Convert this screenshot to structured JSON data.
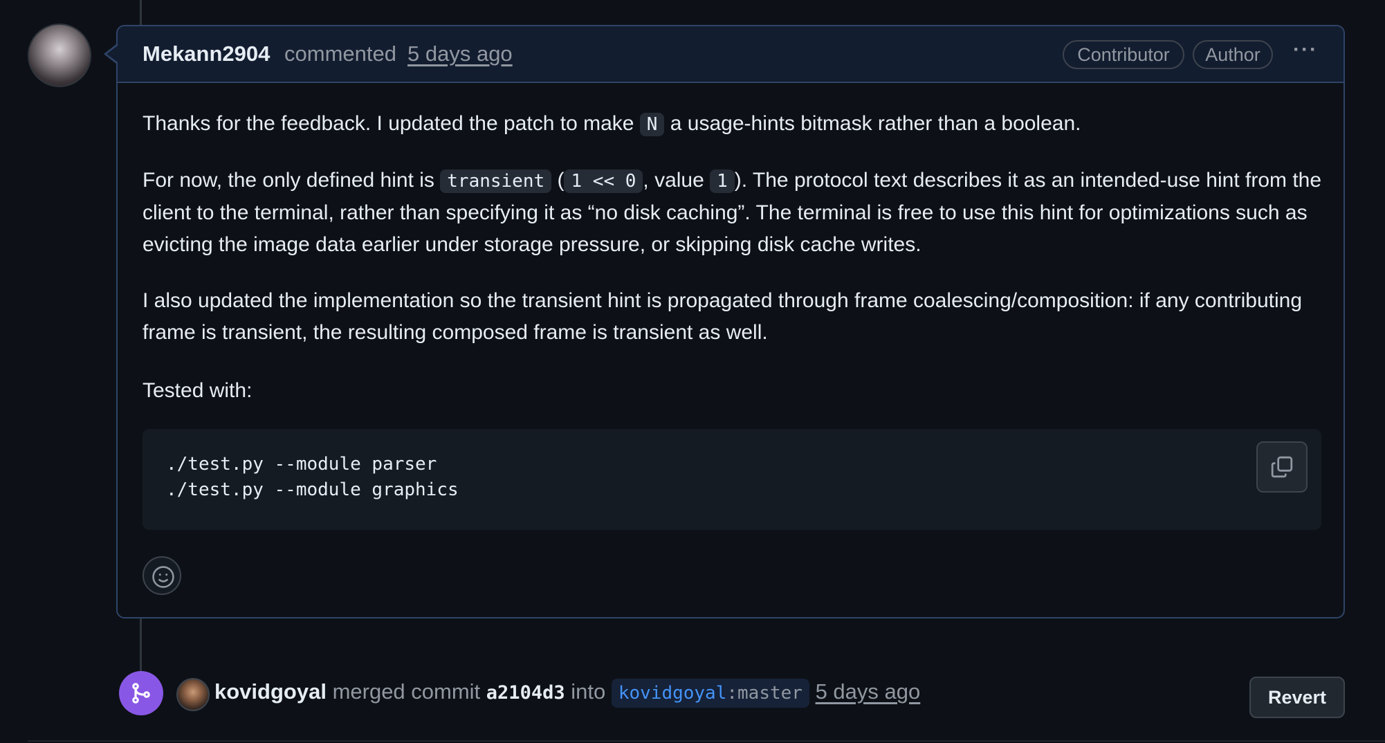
{
  "comment": {
    "author": "Mekann2904",
    "action": "commented",
    "timestamp": "5 days ago",
    "badges": [
      "Contributor",
      "Author"
    ],
    "more_label": "···",
    "paragraphs": {
      "p1_before": "Thanks for the feedback. I updated the patch to make ",
      "p1_code": "N",
      "p1_after": " a usage-hints bitmask rather than a boolean.",
      "p2_before": "For now, the only defined hint is ",
      "p2_code1": "transient",
      "p2_mid1": " (",
      "p2_code2": "1 << 0",
      "p2_mid2": ", value ",
      "p2_code3": "1",
      "p2_after": "). The protocol text describes it as an intended-use hint from the client to the terminal, rather than specifying it as “no disk caching”. The terminal is free to use this hint for optimizations such as evicting the image data earlier under storage pressure, or skipping disk cache writes.",
      "p3": "I also updated the implementation so the transient hint is propagated through frame coalescing/composition: if any contributing frame is transient, the resulting composed frame is transient as well.",
      "p4": "Tested with:"
    },
    "code_lines": [
      "./test.py --module parser",
      "./test.py --module graphics"
    ]
  },
  "merge_event": {
    "user": "kovidgoyal",
    "action": "merged commit",
    "sha": "a2104d3",
    "into": "into",
    "branch_owner": "kovidgoyal",
    "branch_sep": ":",
    "branch_name": "master",
    "timestamp": "5 days ago",
    "revert_label": "Revert"
  },
  "colors": {
    "background": "#0d1117",
    "comment_border": "#2f4468",
    "header_bg": "#131d30",
    "merge_purple": "#8957e5",
    "link_blue": "#4493f8"
  },
  "icons": {
    "copy": "copy-icon",
    "emoji": "smiley-icon",
    "merge": "git-merge-icon"
  }
}
